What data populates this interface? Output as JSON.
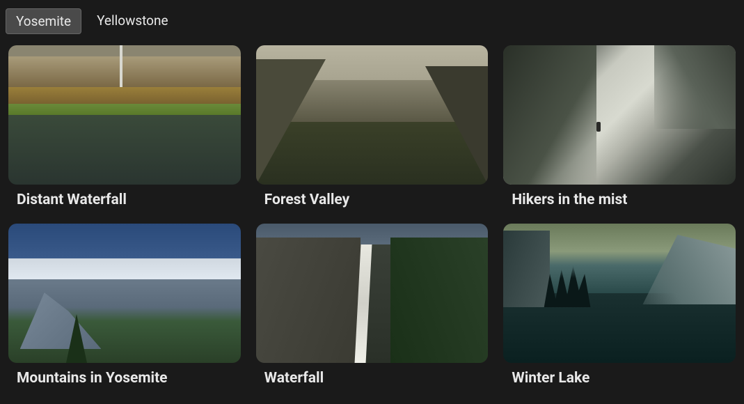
{
  "tabs": [
    {
      "label": "Yosemite",
      "active": true
    },
    {
      "label": "Yellowstone",
      "active": false
    }
  ],
  "gallery": [
    {
      "caption": "Distant Waterfall",
      "thumbClass": "thumb-distant-waterfall"
    },
    {
      "caption": "Forest Valley",
      "thumbClass": "thumb-forest-valley"
    },
    {
      "caption": "Hikers in the mist",
      "thumbClass": "thumb-hikers-mist"
    },
    {
      "caption": "Mountains in Yosemite",
      "thumbClass": "thumb-mountains-yosemite"
    },
    {
      "caption": "Waterfall",
      "thumbClass": "thumb-waterfall"
    },
    {
      "caption": "Winter Lake",
      "thumbClass": "thumb-winter-lake"
    }
  ]
}
